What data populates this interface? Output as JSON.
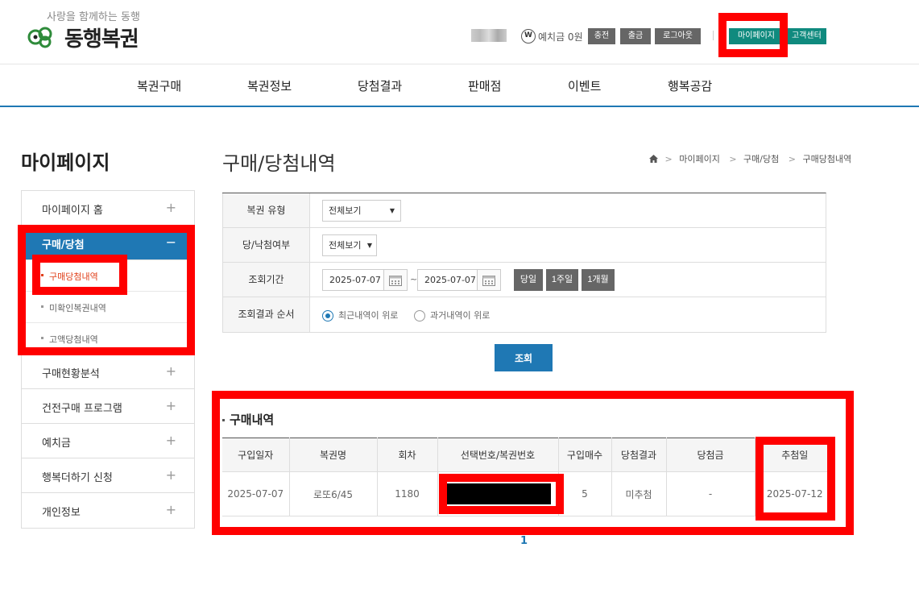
{
  "header": {
    "logo_slogan": "사랑을 함께하는 동행",
    "logo_name": "동행복권",
    "deposit_coin": "W",
    "deposit_label": "예치금 0원",
    "buttons": {
      "charge": "충전",
      "withdraw": "출금",
      "logout": "로그아웃",
      "mypage": "마이페이지",
      "customer_center": "고객센터"
    }
  },
  "gnb": [
    "복권구매",
    "복권정보",
    "당첨결과",
    "판매점",
    "이벤트",
    "행복공감"
  ],
  "lnb": {
    "title": "마이페이지",
    "items": [
      {
        "label": "마이페이지 홈",
        "icon": "+"
      },
      {
        "label": "구매/당첨",
        "icon": "−"
      },
      {
        "label": "구매현황분석",
        "icon": "+"
      },
      {
        "label": "건전구매 프로그램",
        "icon": "+"
      },
      {
        "label": "예치금",
        "icon": "+"
      },
      {
        "label": "행복더하기 신청",
        "icon": "+"
      },
      {
        "label": "개인정보",
        "icon": "+"
      }
    ],
    "sub_items": [
      {
        "label": "구매당첨내역"
      },
      {
        "label": "미확인복권내역"
      },
      {
        "label": "고액당첨내역"
      }
    ]
  },
  "main": {
    "page_title": "구매/당첨내역",
    "breadcrumb": [
      "마이페이지",
      "구매/당첨",
      "구매당첨내역"
    ],
    "search": {
      "type_label": "복권 유형",
      "type_value": "전체보기",
      "win_label": "당/낙첨여부",
      "win_value": "전체보기",
      "period_label": "조회기간",
      "date_from": "2025-07-07",
      "date_to": "2025-07-07",
      "tilde": "~",
      "period_buttons": [
        "당일",
        "1주일",
        "1개월"
      ],
      "order_label": "조회결과 순서",
      "order_options": [
        "최근내역이 위로",
        "과거내역이 위로"
      ],
      "submit": "조회"
    },
    "result": {
      "section_title": "구매내역",
      "columns": [
        "구입일자",
        "복권명",
        "회차",
        "선택번호/복권번호",
        "구입매수",
        "당첨결과",
        "당첨금",
        "추첨일"
      ],
      "rows": [
        {
          "date": "2025-07-07",
          "name": "로또6/45",
          "round": "1180",
          "number": "",
          "count": "5",
          "result": "미추첨",
          "prize": "-",
          "draw_date": "2025-07-12"
        }
      ]
    },
    "pager": {
      "current": "1"
    }
  },
  "colors": {
    "accent_blue": "#1f78b4",
    "teal": "#0f8a7e",
    "annotation_red": "#ff0000"
  }
}
